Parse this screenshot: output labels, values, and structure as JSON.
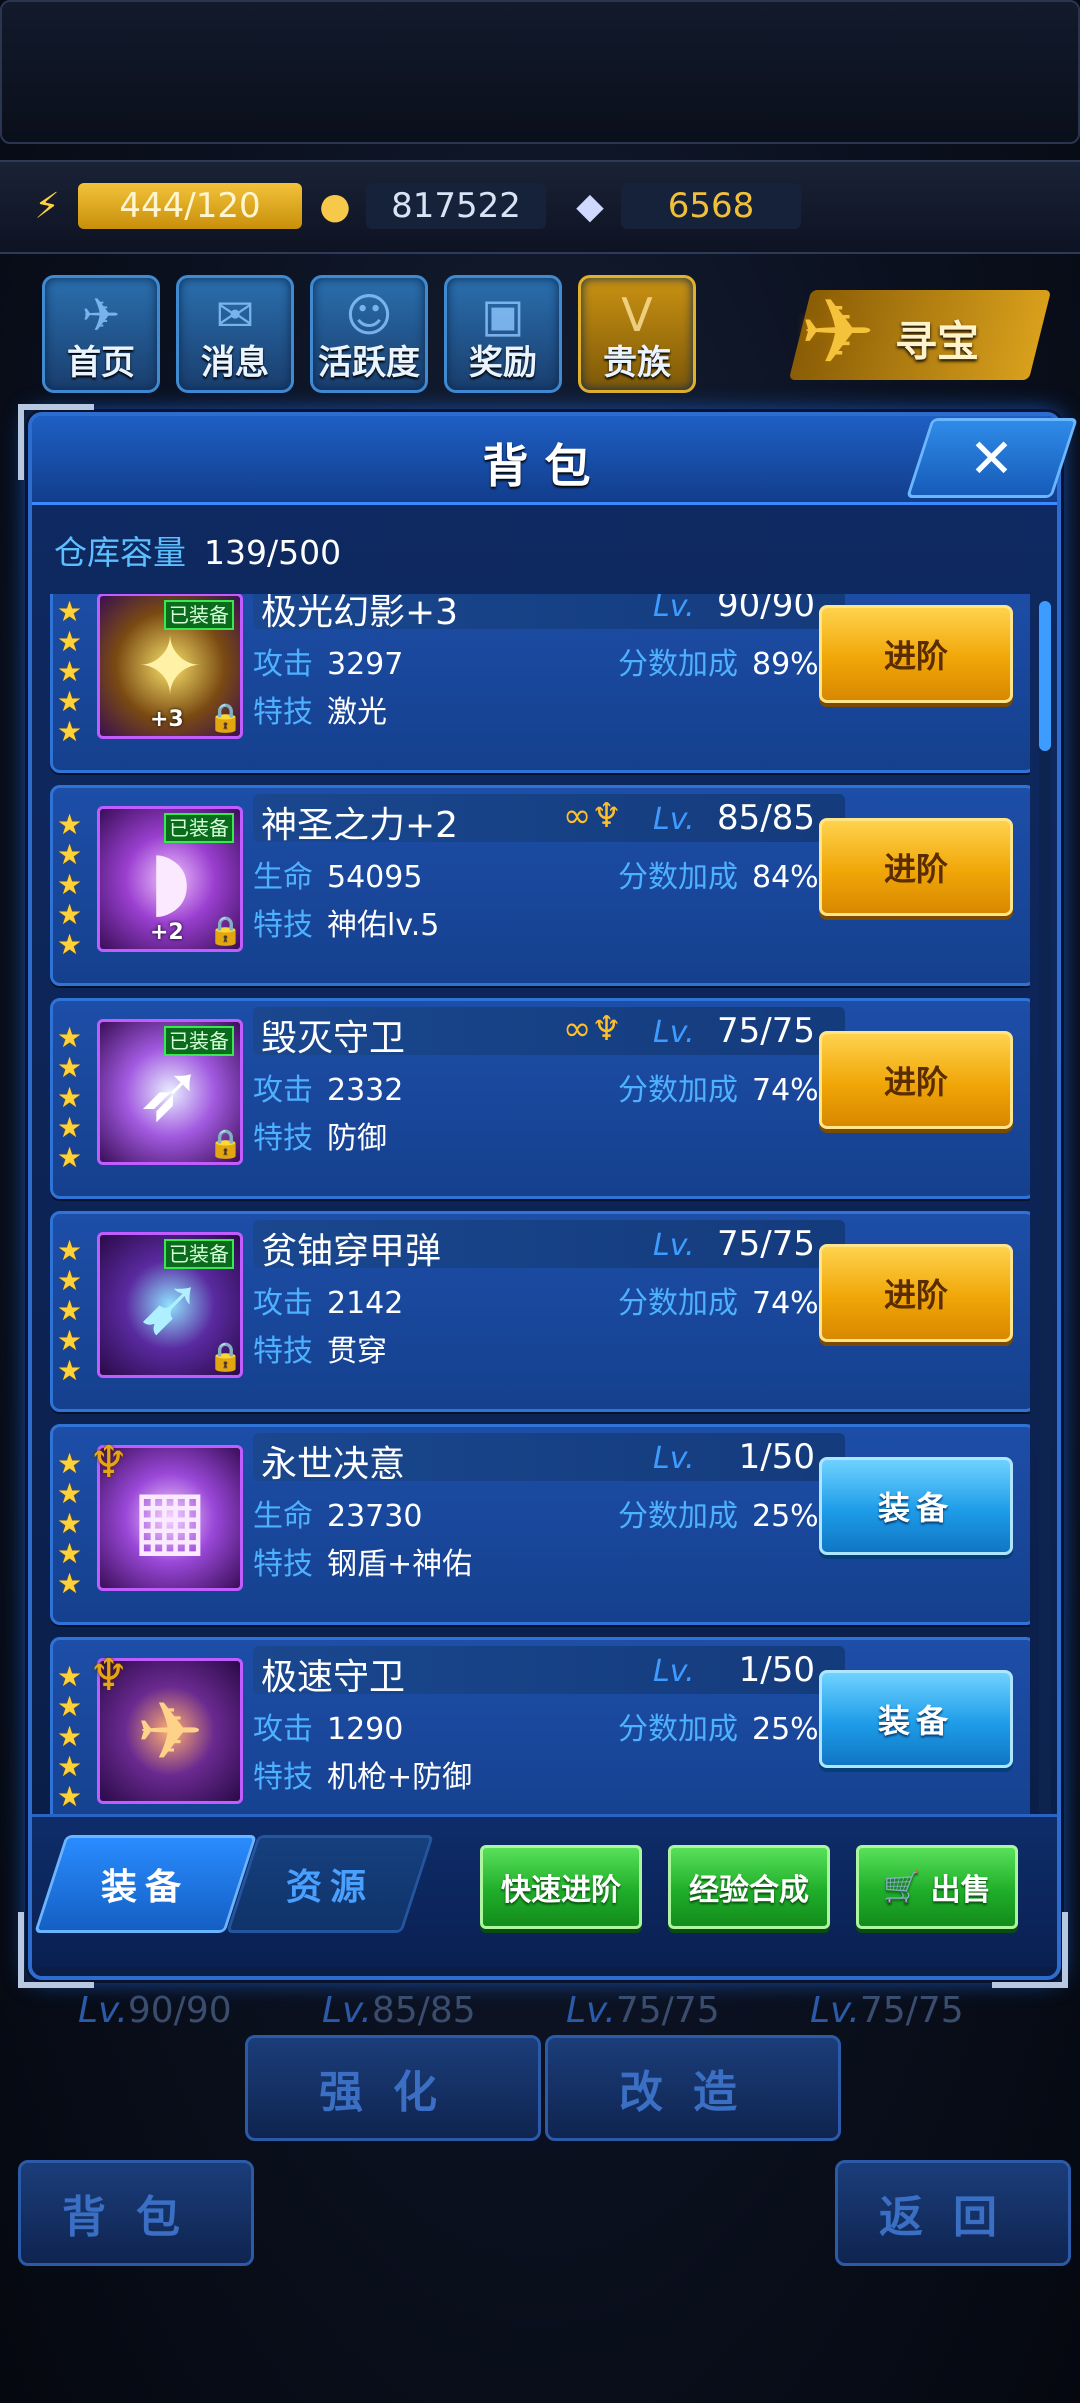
{
  "resources": {
    "energy": "444/120",
    "coins": "817522",
    "gems": "6568"
  },
  "nav": [
    {
      "label": "首页",
      "icon": "home-icon"
    },
    {
      "label": "消息",
      "icon": "mail-icon"
    },
    {
      "label": "活跃度",
      "icon": "activity-icon"
    },
    {
      "label": "奖励",
      "icon": "reward-icon"
    },
    {
      "label": "贵族",
      "icon": "noble-icon"
    }
  ],
  "treasure_label": "寻宝",
  "modal": {
    "title": "背包",
    "close": "✕",
    "capacity_label": "仓库容量",
    "capacity_value": "139/500"
  },
  "items": [
    {
      "name": "极光幻影+3",
      "lv_label": "Lv.",
      "lv": "90/90",
      "stat_label": "攻击",
      "stat_value": "3297",
      "bonus_label": "分数加成",
      "bonus_value": "89%",
      "skill_label": "特技",
      "skill_value": "激光",
      "equipped": "已装备",
      "plus": "+3",
      "button": "进阶"
    },
    {
      "name": "神圣之力+2",
      "lv_label": "Lv.",
      "lv": "85/85",
      "stat_label": "生命",
      "stat_value": "54095",
      "bonus_label": "分数加成",
      "bonus_value": "84%",
      "skill_label": "特技",
      "skill_value": "神佑lv.5",
      "equipped": "已装备",
      "plus": "+2",
      "button": "进阶"
    },
    {
      "name": "毁灭守卫",
      "lv_label": "Lv.",
      "lv": "75/75",
      "stat_label": "攻击",
      "stat_value": "2332",
      "bonus_label": "分数加成",
      "bonus_value": "74%",
      "skill_label": "特技",
      "skill_value": "防御",
      "equipped": "已装备",
      "button": "进阶"
    },
    {
      "name": "贫铀穿甲弹",
      "lv_label": "Lv.",
      "lv": "75/75",
      "stat_label": "攻击",
      "stat_value": "2142",
      "bonus_label": "分数加成",
      "bonus_value": "74%",
      "skill_label": "特技",
      "skill_value": "贯穿",
      "equipped": "已装备",
      "button": "进阶"
    },
    {
      "name": "永世决意",
      "lv_label": "Lv.",
      "lv": "1/50",
      "stat_label": "生命",
      "stat_value": "23730",
      "bonus_label": "分数加成",
      "bonus_value": "25%",
      "skill_label": "特技",
      "skill_value": "钢盾+神佑",
      "button": "装备"
    },
    {
      "name": "极速守卫",
      "lv_label": "Lv.",
      "lv": "1/50",
      "stat_label": "攻击",
      "stat_value": "1290",
      "bonus_label": "分数加成",
      "bonus_value": "25%",
      "skill_label": "特技",
      "skill_value": "机枪+防御",
      "button": "装备"
    }
  ],
  "tabs": {
    "active": "装备",
    "inactive": "资源"
  },
  "actions": {
    "quick_upgrade": "快速进阶",
    "exp_merge": "经验合成",
    "sell": "出售"
  },
  "under": {
    "lv_label": "Lv.",
    "lv_values": [
      "90/90",
      "85/85",
      "75/75",
      "75/75"
    ],
    "strengthen": "强化",
    "modify": "改造",
    "backpack": "背包",
    "back": "返回"
  }
}
